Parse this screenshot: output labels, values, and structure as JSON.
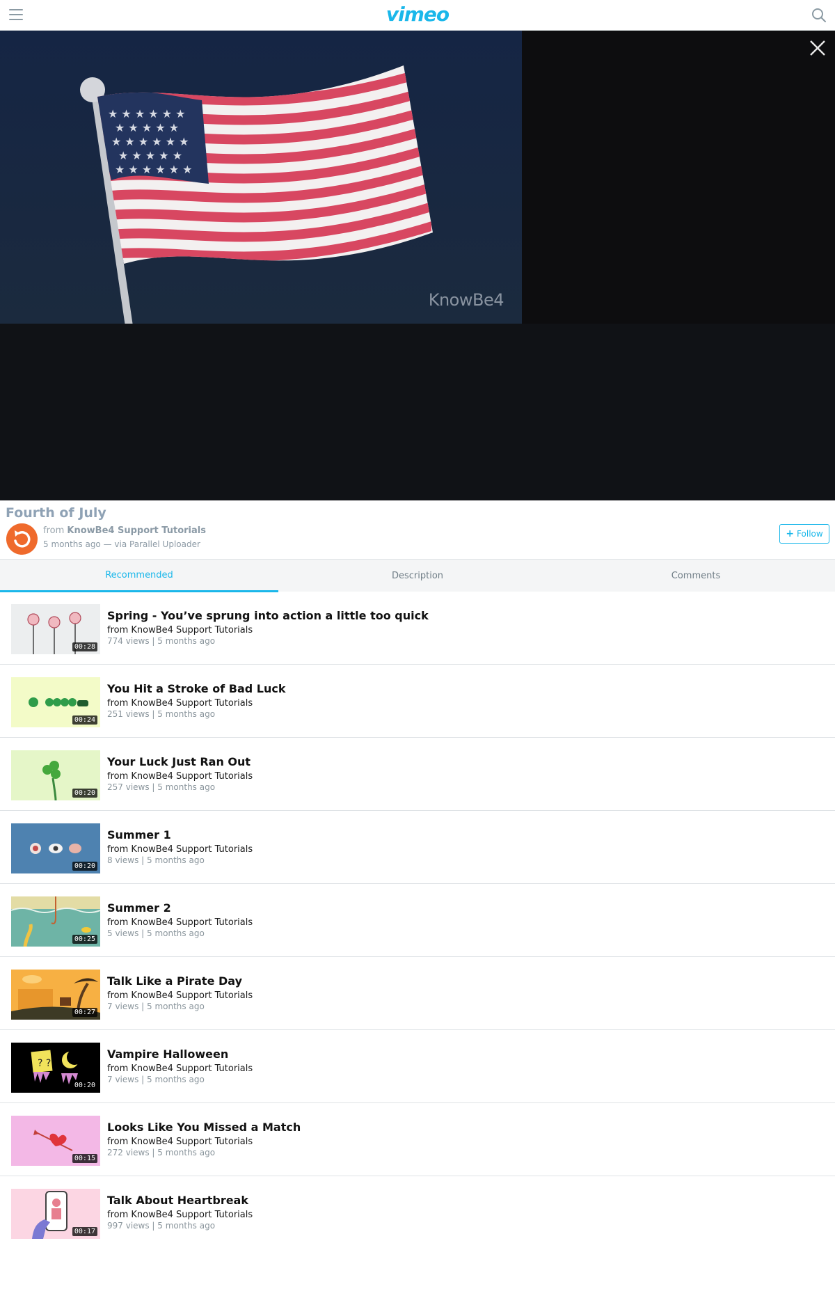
{
  "header": {
    "logo": "vimeo",
    "menu_icon": "hamburger-menu-icon",
    "search_icon": "search-icon"
  },
  "player": {
    "watermark": "KnowBe4",
    "close_icon": "close-icon"
  },
  "video": {
    "title": "Fourth of July",
    "from_prefix": "from",
    "owner": "KnowBe4 Support Tutorials",
    "meta": "5 months ago — via Parallel Uploader",
    "follow_label": "Follow"
  },
  "tabs": [
    {
      "label": "Recommended",
      "active": true
    },
    {
      "label": "Description",
      "active": false
    },
    {
      "label": "Comments",
      "active": false
    }
  ],
  "recommended": [
    {
      "title": "Spring - You’ve sprung into action a little too quick",
      "from": "from KnowBe4 Support Tutorials",
      "meta": "774 views | 5 months ago",
      "duration": "00:28"
    },
    {
      "title": "You Hit a Stroke of Bad Luck",
      "from": "from KnowBe4 Support Tutorials",
      "meta": "251 views | 5 months ago",
      "duration": "00:24"
    },
    {
      "title": "Your Luck Just Ran Out",
      "from": "from KnowBe4 Support Tutorials",
      "meta": "257 views | 5 months ago",
      "duration": "00:20"
    },
    {
      "title": "Summer 1",
      "from": "from KnowBe4 Support Tutorials",
      "meta": "8 views | 5 months ago",
      "duration": "00:20"
    },
    {
      "title": "Summer 2",
      "from": "from KnowBe4 Support Tutorials",
      "meta": "5 views | 5 months ago",
      "duration": "00:25"
    },
    {
      "title": "Talk Like a Pirate Day",
      "from": "from KnowBe4 Support Tutorials",
      "meta": "7 views | 5 months ago",
      "duration": "00:27"
    },
    {
      "title": "Vampire Halloween",
      "from": "from KnowBe4 Support Tutorials",
      "meta": "7 views | 5 months ago",
      "duration": "00:20"
    },
    {
      "title": "Looks Like You Missed a Match",
      "from": "from KnowBe4 Support Tutorials",
      "meta": "272 views | 5 months ago",
      "duration": "00:15"
    },
    {
      "title": "Talk About Heartbreak",
      "from": "from KnowBe4 Support Tutorials",
      "meta": "997 views | 5 months ago",
      "duration": "00:17"
    }
  ],
  "colors": {
    "accent": "#1ab7ea",
    "avatar": "#ef6a2c"
  }
}
